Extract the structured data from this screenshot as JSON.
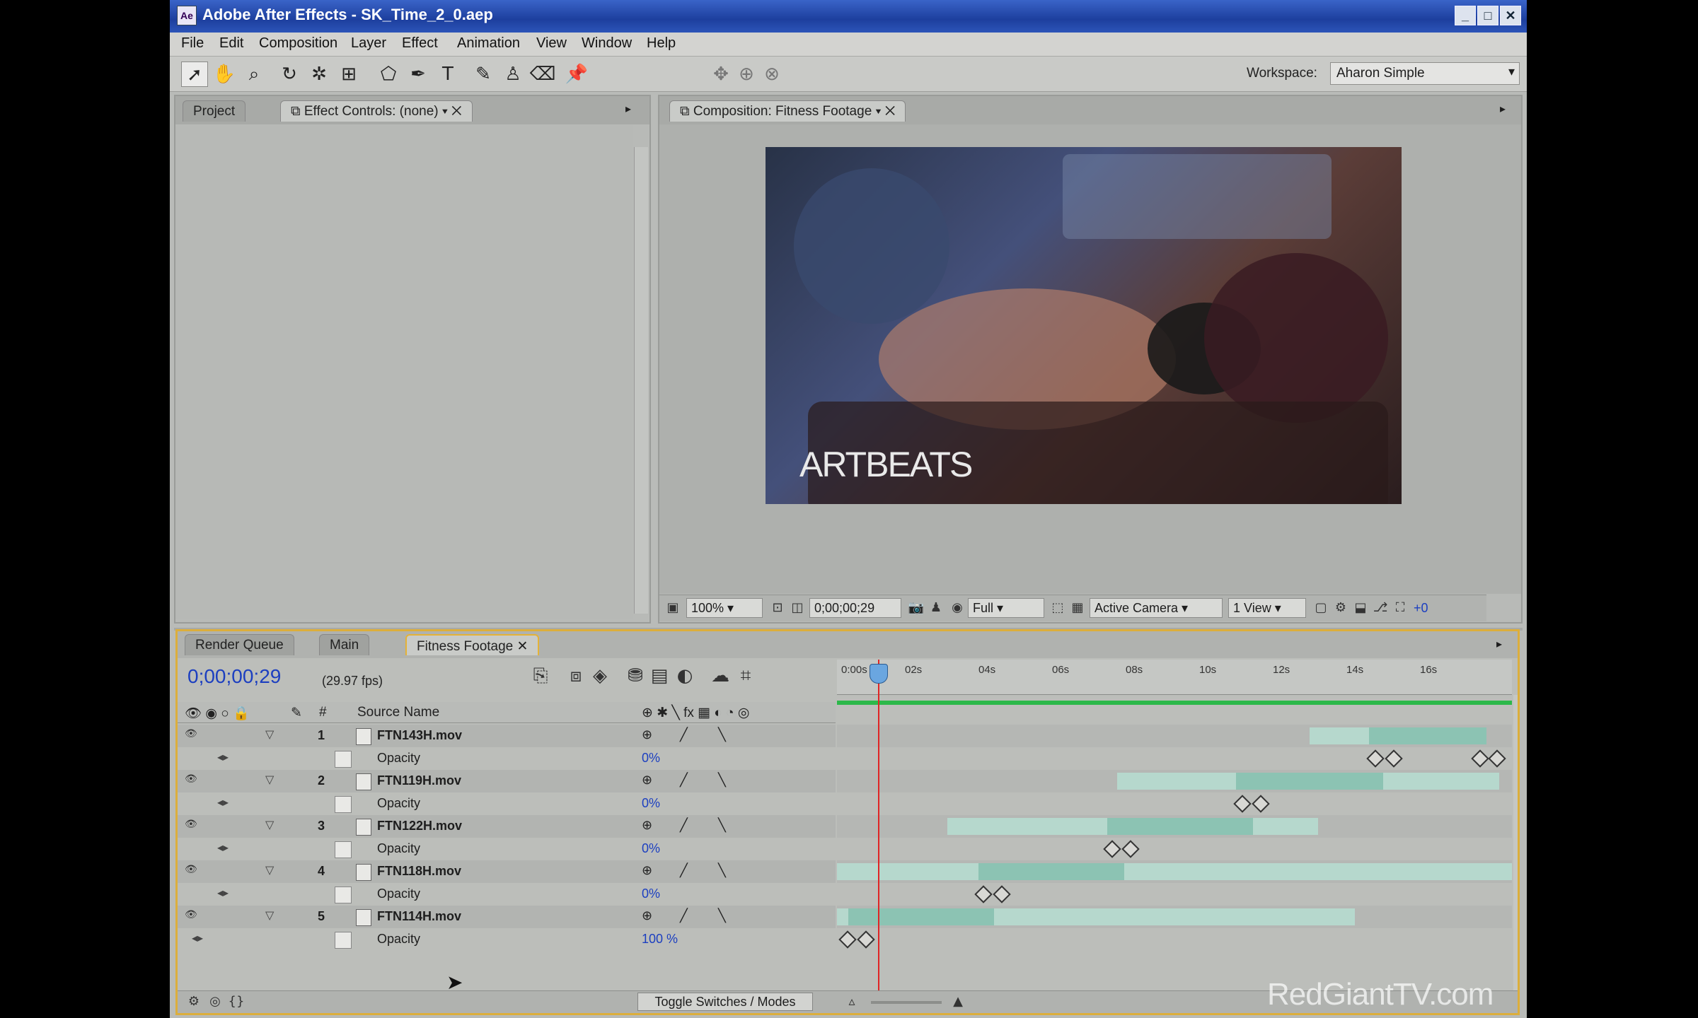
{
  "window": {
    "title": "Adobe After Effects - SK_Time_2_0.aep",
    "minimize": "_",
    "maximize": "□",
    "close": "✕"
  },
  "menu": [
    "File",
    "Edit",
    "Composition",
    "Layer",
    "Effect",
    "Animation",
    "View",
    "Window",
    "Help"
  ],
  "toolbar": {
    "tools": [
      "selection-tool-icon",
      "hand-tool-icon",
      "zoom-tool-icon",
      "rotate-tool-icon",
      "orbit-camera-icon",
      "pan-behind-icon",
      "mask-shape-icon",
      "pen-tool-icon",
      "type-tool-icon",
      "brush-tool-icon",
      "clone-stamp-icon",
      "eraser-icon",
      "puppet-pin-icon"
    ],
    "workspace_label": "Workspace:",
    "workspace_value": "Aharon Simple"
  },
  "left_panel": {
    "tabs": [
      "Project",
      "Effect Controls: (none)"
    ]
  },
  "comp_panel": {
    "tab": "Composition: Fitness Footage",
    "watermark": "ARTBEATS",
    "zoom": "100%",
    "timecode": "0;00;00;29",
    "resolution": "Full",
    "camera": "Active Camera",
    "views": "1 View",
    "exposure": "+0"
  },
  "timeline": {
    "tabs": [
      "Render Queue",
      "Main",
      "Fitness Footage"
    ],
    "timecode": "0;00;00;29",
    "fps": "(29.97 fps)",
    "column_source": "Source Name",
    "column_num": "#",
    "ruler_ticks": [
      "0:00s",
      "02s",
      "04s",
      "06s",
      "08s",
      "10s",
      "12s",
      "14s",
      "16s"
    ],
    "layers": [
      {
        "num": "1",
        "name": "FTN143H.mov",
        "prop": "Opacity",
        "value": "0%"
      },
      {
        "num": "2",
        "name": "FTN119H.mov",
        "prop": "Opacity",
        "value": "0%"
      },
      {
        "num": "3",
        "name": "FTN122H.mov",
        "prop": "Opacity",
        "value": "0%"
      },
      {
        "num": "4",
        "name": "FTN118H.mov",
        "prop": "Opacity",
        "value": "0%"
      },
      {
        "num": "5",
        "name": "FTN114H.mov",
        "prop": "Opacity",
        "value": "100 %"
      }
    ],
    "toggle_label": "Toggle Switches / Modes",
    "watermark": "RedGiantTV.com"
  },
  "colors": {
    "accent_timeline_border": "#dcae3c",
    "timecode_blue": "#1c3fc0",
    "work_area_green": "#2cb84a",
    "cti_red": "#e02424",
    "layer_bar": "#b6d8cd",
    "layer_bar_selected": "#8cc3b3"
  }
}
